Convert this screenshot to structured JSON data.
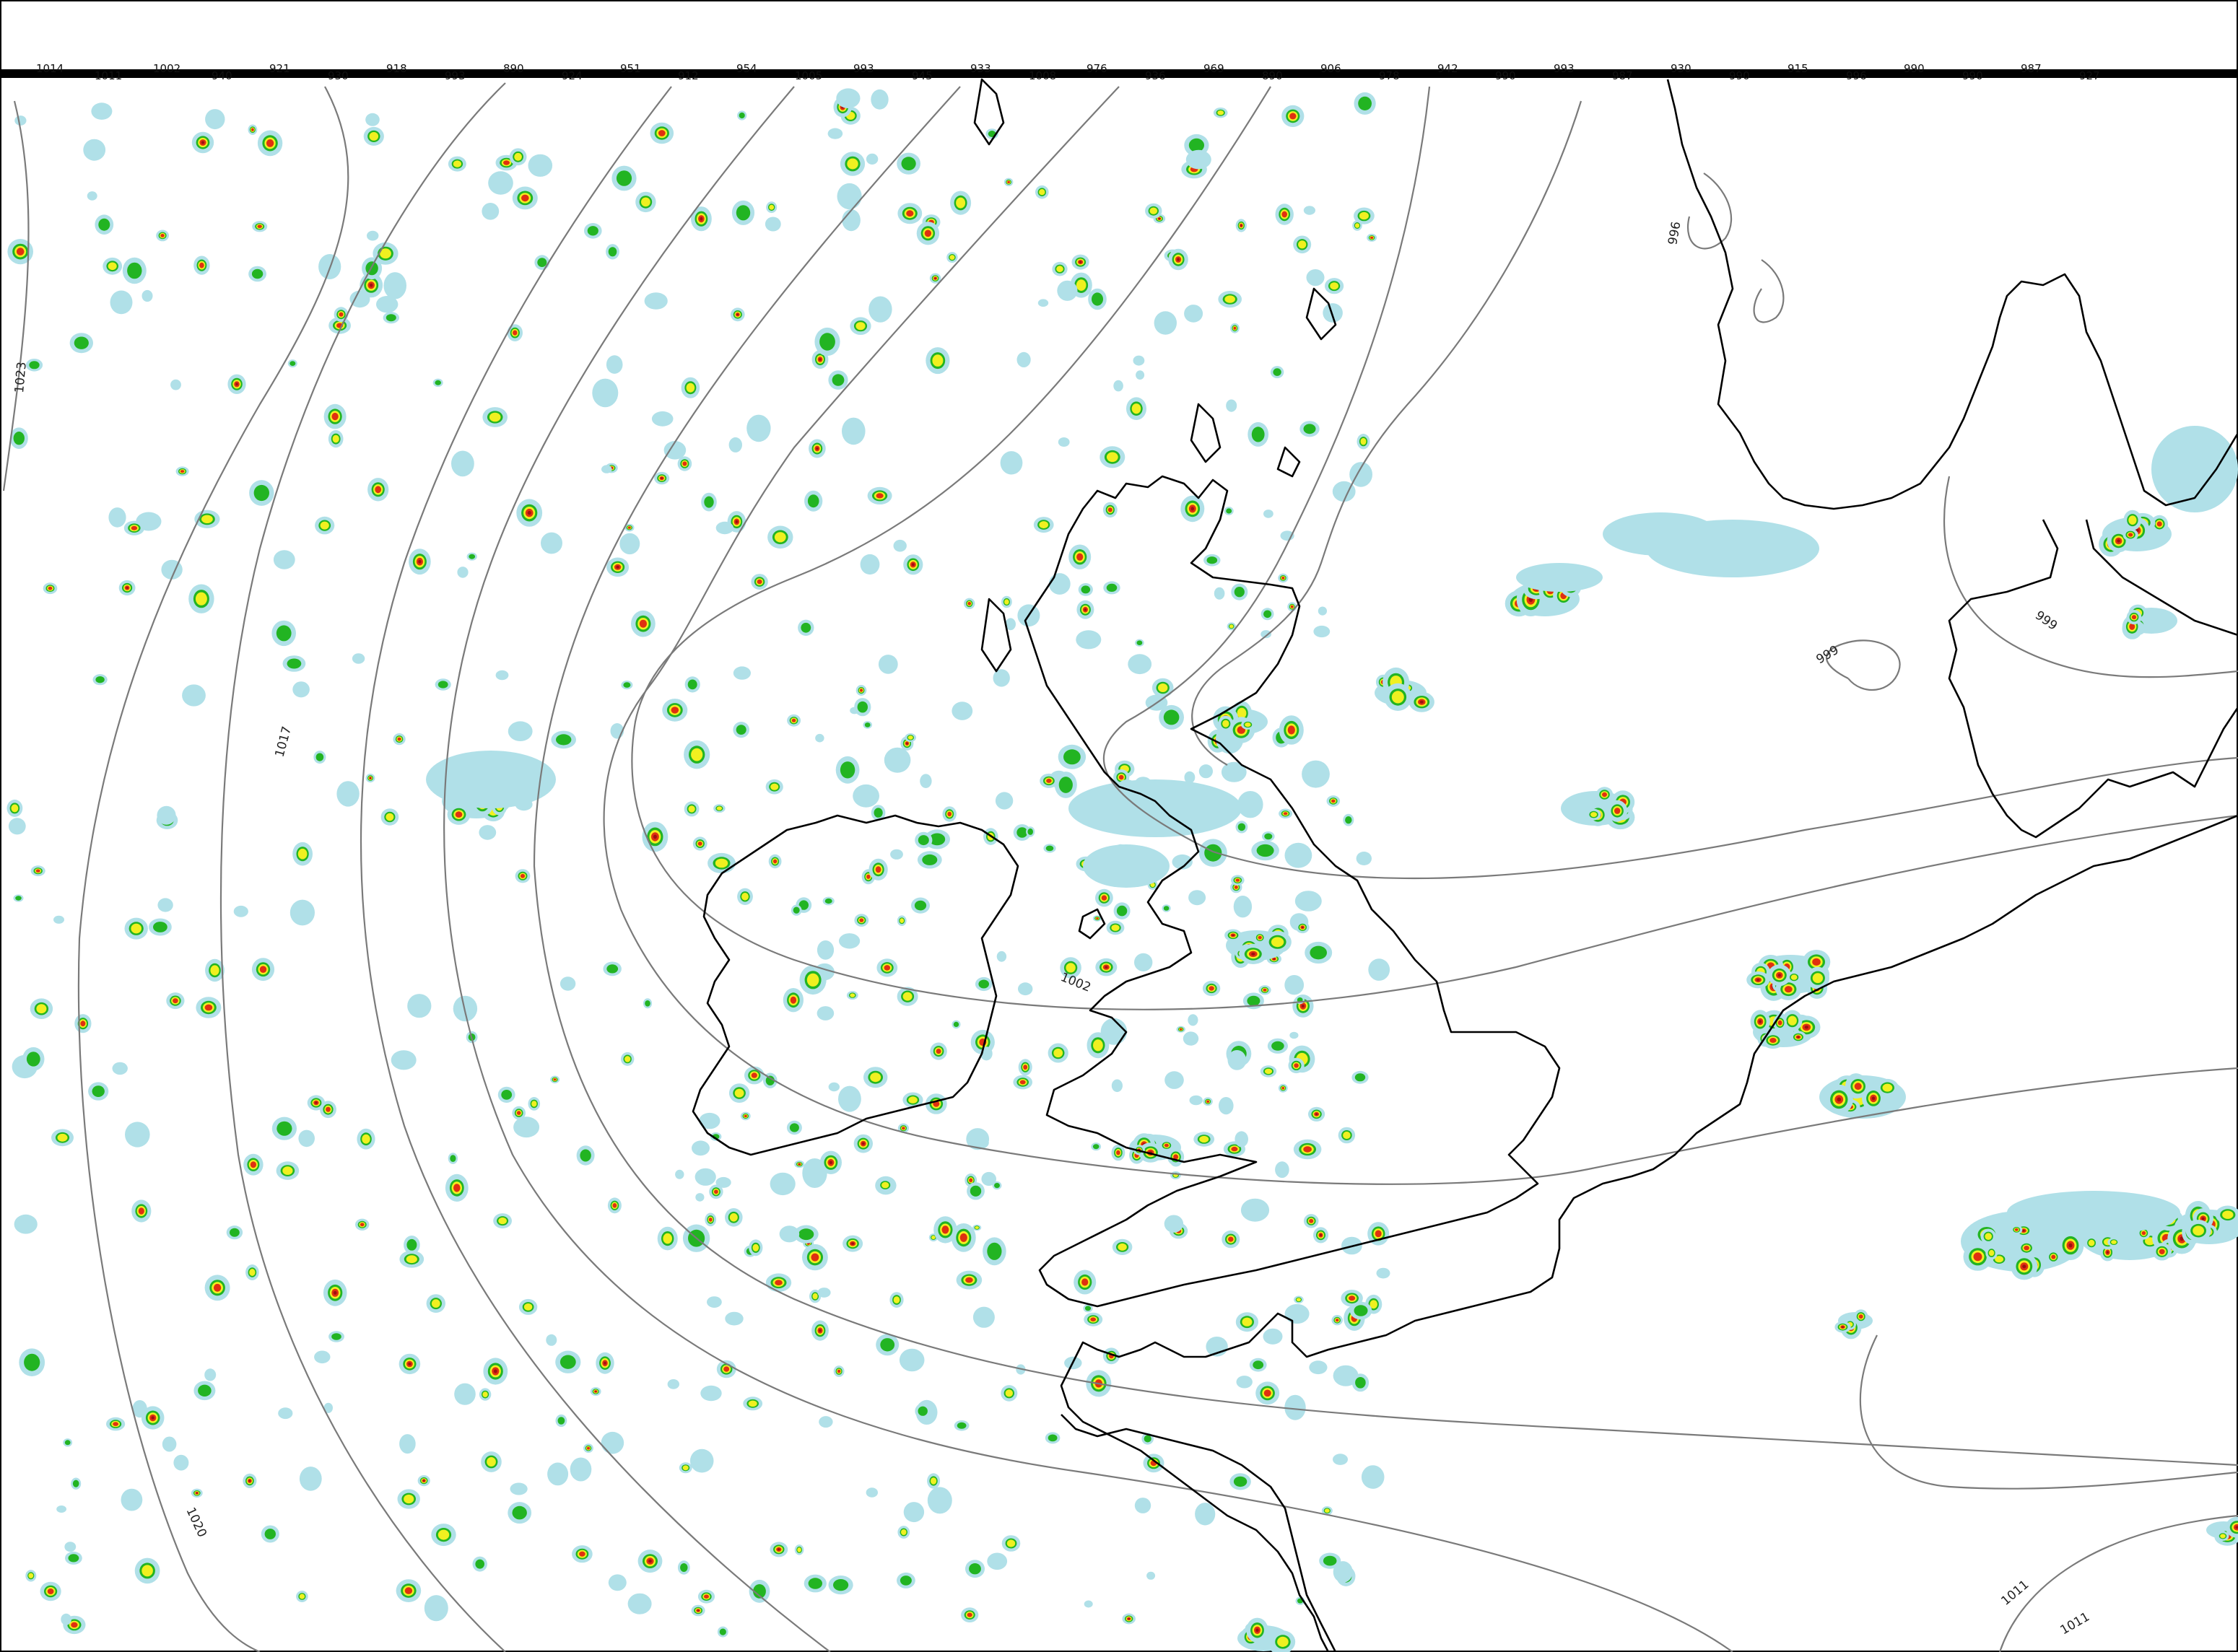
{
  "map": {
    "colors": {
      "background": "#ffffff",
      "coastline": "#000000",
      "isobar": "#7a7a7a",
      "precip_light": "#b0e0e8",
      "precip_moderate": "#22b422",
      "precip_heavy": "#f0f020",
      "precip_very_heavy": "#e03010",
      "precip_extreme": "#a01010"
    },
    "isobar_labels": {
      "iso_1023": "1023",
      "iso_1017": "1017",
      "iso_1020": "1020",
      "iso_1002": "1002",
      "iso_999_a": "999",
      "iso_999_b": "999",
      "iso_996": "996",
      "iso_1011_a": "1011",
      "iso_1011_b": "1011"
    },
    "top_labels": [
      "1014",
      "1011",
      "1002",
      "940",
      "921",
      "930",
      "918",
      "993",
      "890",
      "924",
      "951",
      "912",
      "954",
      "1005",
      "993",
      "945",
      "933",
      "1008",
      "976",
      "936",
      "969",
      "890",
      "906",
      "978",
      "942",
      "990",
      "993",
      "987",
      "930",
      "990",
      "915",
      "996",
      "990",
      "990",
      "987",
      "927"
    ]
  }
}
